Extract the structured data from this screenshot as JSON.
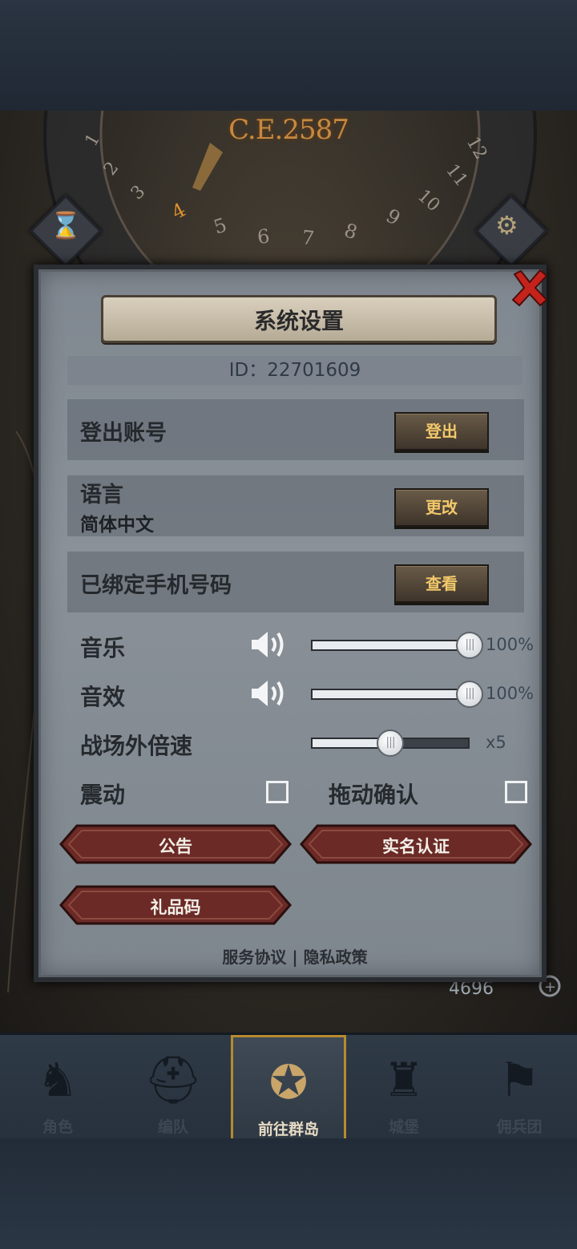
{
  "game_bg": {
    "era_label": "C.E.2587",
    "dial_numbers": [
      "1",
      "2",
      "3",
      "4",
      "5",
      "6",
      "7",
      "8",
      "9",
      "10",
      "11",
      "12"
    ],
    "resource_value": "4696"
  },
  "settings": {
    "title": "系统设置",
    "id_text": "ID：22701609",
    "logout": {
      "label": "登出账号",
      "button": "登出"
    },
    "language": {
      "label": "语言",
      "value": "简体中文",
      "button": "更改"
    },
    "phone": {
      "label": "已绑定手机号码",
      "button": "查看"
    },
    "music": {
      "label": "音乐",
      "percent_text": "100%",
      "level": 1.0
    },
    "sfx": {
      "label": "音效",
      "percent_text": "100%",
      "level": 1.0
    },
    "speed": {
      "label": "战场外倍速",
      "value_text": "x5",
      "level": 0.5
    },
    "vibrate": {
      "label": "震动",
      "checked": false
    },
    "drag_confirm": {
      "label": "拖动确认",
      "checked": false
    },
    "buttons": {
      "notice": "公告",
      "realname": "实名认证",
      "gift": "礼品码"
    },
    "footer": {
      "service": "服务协议",
      "separator": "|",
      "privacy": "隐私政策"
    }
  },
  "nav": {
    "items": [
      {
        "label": "角色",
        "icon": "knight-icon"
      },
      {
        "label": "编队",
        "icon": "helmet-icon"
      },
      {
        "label": "前往群岛",
        "icon": "compass-icon"
      },
      {
        "label": "城堡",
        "icon": "castle-icon"
      },
      {
        "label": "佣兵团",
        "icon": "banner-icon"
      }
    ],
    "active_index": 2
  },
  "colors": {
    "accent_gold": "#f2c86a",
    "panel_bg": "#8a9198",
    "button_red": "#6b2a26",
    "close_red": "#c4231c"
  }
}
